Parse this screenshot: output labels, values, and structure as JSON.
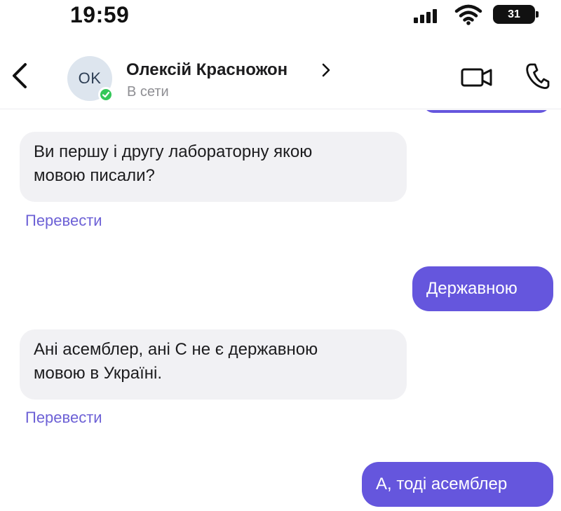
{
  "status_bar": {
    "time": "19:59",
    "battery": "31"
  },
  "header": {
    "avatar_initials": "OK",
    "contact_name": "Олексій Красножон",
    "contact_status": "В сети"
  },
  "messages": [
    {
      "direction": "incoming",
      "text_lines": [
        "Ви першу і другу лабораторну якою",
        "мовою писали?"
      ],
      "translate_label": "Перевести"
    },
    {
      "direction": "outgoing",
      "text": "Державною"
    },
    {
      "direction": "incoming",
      "text_lines": [
        "Ані асемблер, ані С не є державною",
        "мовою в Україні."
      ],
      "translate_label": "Перевести"
    },
    {
      "direction": "outgoing",
      "text": "А, тоді асемблер"
    }
  ],
  "colors": {
    "outgoing_bubble": "#6556dd",
    "incoming_bubble": "#f1f1f4",
    "link": "#6d61d6",
    "online": "#34c759"
  },
  "icons": [
    "back-chevron-icon",
    "video-call-icon",
    "phone-call-icon",
    "signal-icon",
    "wifi-icon",
    "battery-icon",
    "online-check-icon"
  ]
}
